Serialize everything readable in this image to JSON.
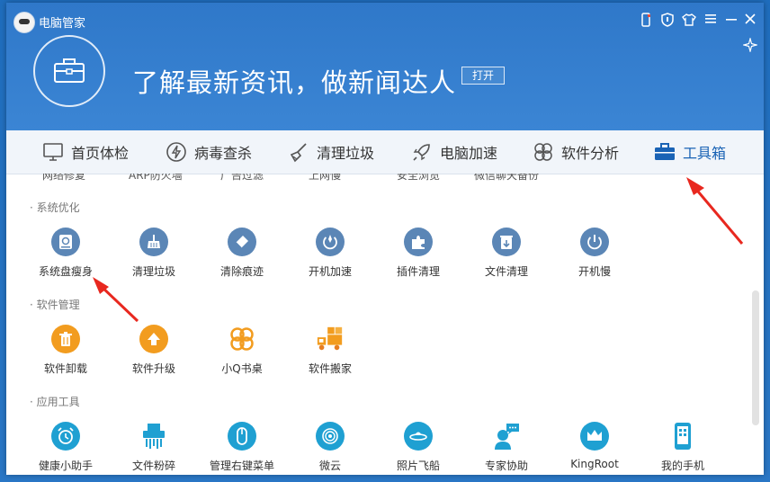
{
  "app": {
    "title": "电脑管家"
  },
  "banner": {
    "headline": "了解最新资讯，做新闻达人",
    "open_label": "打开"
  },
  "tabs": [
    {
      "label": "首页体检",
      "icon": "monitor-icon"
    },
    {
      "label": "病毒查杀",
      "icon": "lightning-icon"
    },
    {
      "label": "清理垃圾",
      "icon": "broom-icon"
    },
    {
      "label": "电脑加速",
      "icon": "rocket-icon"
    },
    {
      "label": "软件分析",
      "icon": "clover-icon"
    },
    {
      "label": "工具箱",
      "icon": "toolbox-icon",
      "active": true
    }
  ],
  "clipped_row": [
    "网络修复",
    "ARP防火墙",
    "广告过滤",
    "上网慢",
    "安全浏览",
    "微信聊天备份"
  ],
  "sections": [
    {
      "title": "· 系统优化",
      "tools": [
        "系统盘瘦身",
        "清理垃圾",
        "清除痕迹",
        "开机加速",
        "插件清理",
        "文件清理",
        "开机慢"
      ]
    },
    {
      "title": "· 软件管理",
      "tools": [
        "软件卸载",
        "软件升级",
        "小Q书桌",
        "软件搬家"
      ]
    },
    {
      "title": "· 应用工具",
      "tools": [
        "健康小助手",
        "文件粉碎",
        "管理右键菜单",
        "微云",
        "照片飞船",
        "专家协助",
        "KingRoot",
        "我的手机"
      ]
    }
  ],
  "colors": {
    "accent": "#2f78c9",
    "blue_icon": "#5b86b6",
    "orange_icon": "#f29c1f",
    "teal_icon": "#1fa0d2",
    "arrow": "#e8281f"
  }
}
